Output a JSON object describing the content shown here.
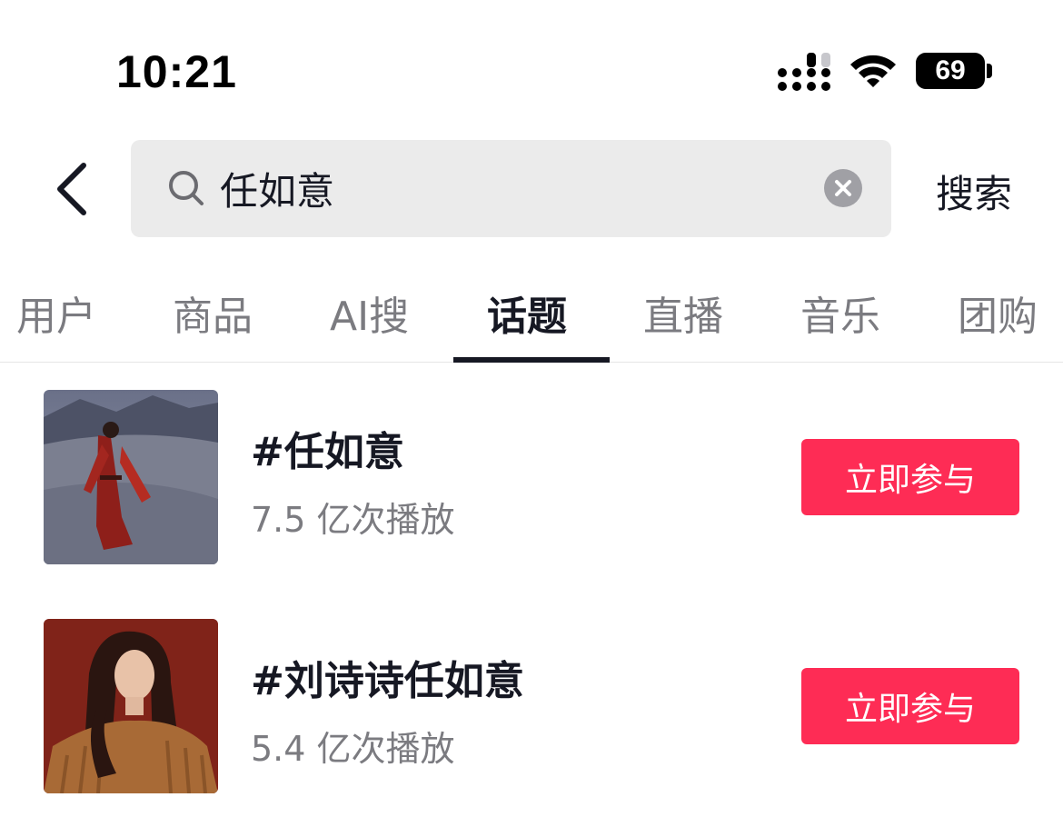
{
  "status_bar": {
    "time": "10:21",
    "battery_level": "69",
    "icons": [
      "cellular-signal-icon",
      "wifi-icon",
      "battery-icon"
    ]
  },
  "search": {
    "back_icon": "chevron-left-icon",
    "search_icon": "search-icon",
    "query": "任如意",
    "clear_icon": "clear-circle-icon",
    "action_label": "搜索"
  },
  "tabs": {
    "items": [
      {
        "label": "用户"
      },
      {
        "label": "商品"
      },
      {
        "label": "AI搜"
      },
      {
        "label": "话题"
      },
      {
        "label": "直播"
      },
      {
        "label": "音乐"
      },
      {
        "label": "团购"
      }
    ],
    "active": "话题"
  },
  "topics": [
    {
      "title": "#任如意",
      "views": "7.5 亿次播放",
      "button": "立即参与"
    },
    {
      "title": "#刘诗诗任如意",
      "views": "5.4 亿次播放",
      "button": "立即参与"
    }
  ],
  "colors": {
    "accent": "#fe2c55",
    "text_primary": "#161823",
    "text_secondary": "#7b7b80",
    "search_bg": "#ebebeb"
  }
}
